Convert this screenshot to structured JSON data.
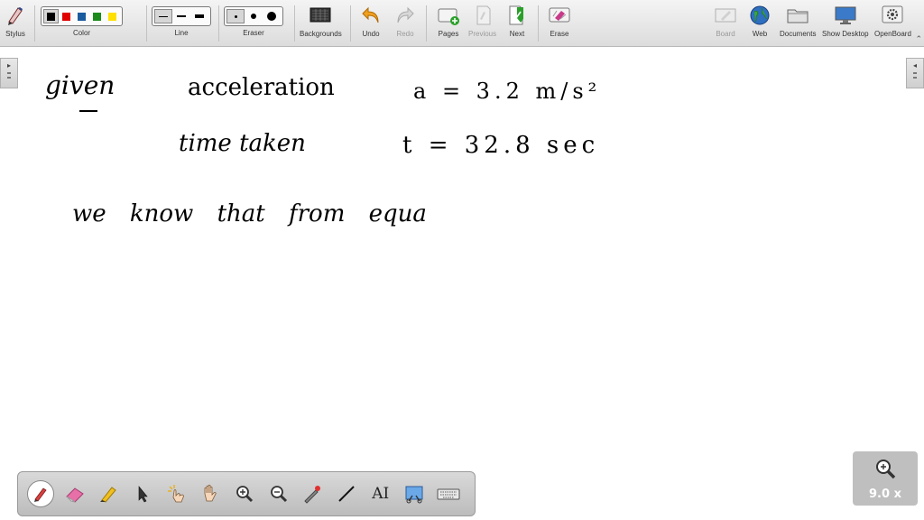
{
  "toolbar": {
    "stylus_label": "Stylus",
    "color_label": "Color",
    "line_label": "Line",
    "eraser_label": "Eraser",
    "backgrounds_label": "Backgrounds",
    "undo_label": "Undo",
    "redo_label": "Redo",
    "pages_label": "Pages",
    "previous_label": "Previous",
    "next_label": "Next",
    "erase_label": "Erase",
    "board_label": "Board",
    "web_label": "Web",
    "documents_label": "Documents",
    "show_desktop_label": "Show Desktop",
    "openboard_label": "OpenBoard",
    "colors": [
      "#000000",
      "#e00000",
      "#1a5a9e",
      "#1a8a1a",
      "#ffe000"
    ],
    "selected_color_index": 0,
    "selected_line_index": 0,
    "selected_eraser_index": 0
  },
  "canvas": {
    "line1_given": "given",
    "line1_term": "acceleration",
    "line1_eq": "a = 3.2 m/s²",
    "line2_term": "time taken",
    "line2_eq": "t = 32.8 sec",
    "line3": "we know that from equa"
  },
  "bottom_toolbar": {
    "tools": [
      "pen-tool",
      "eraser-tool",
      "marker-tool",
      "selector-tool",
      "interact-tool",
      "hand-tool",
      "zoom-in-tool",
      "zoom-out-tool",
      "laser-pointer-tool",
      "line-tool",
      "text-tool",
      "capture-tool",
      "virtual-keyboard-tool"
    ],
    "selected_tool": "pen-tool",
    "text_tool_glyph": "AI"
  },
  "zoom": {
    "value": "9.0 x"
  }
}
